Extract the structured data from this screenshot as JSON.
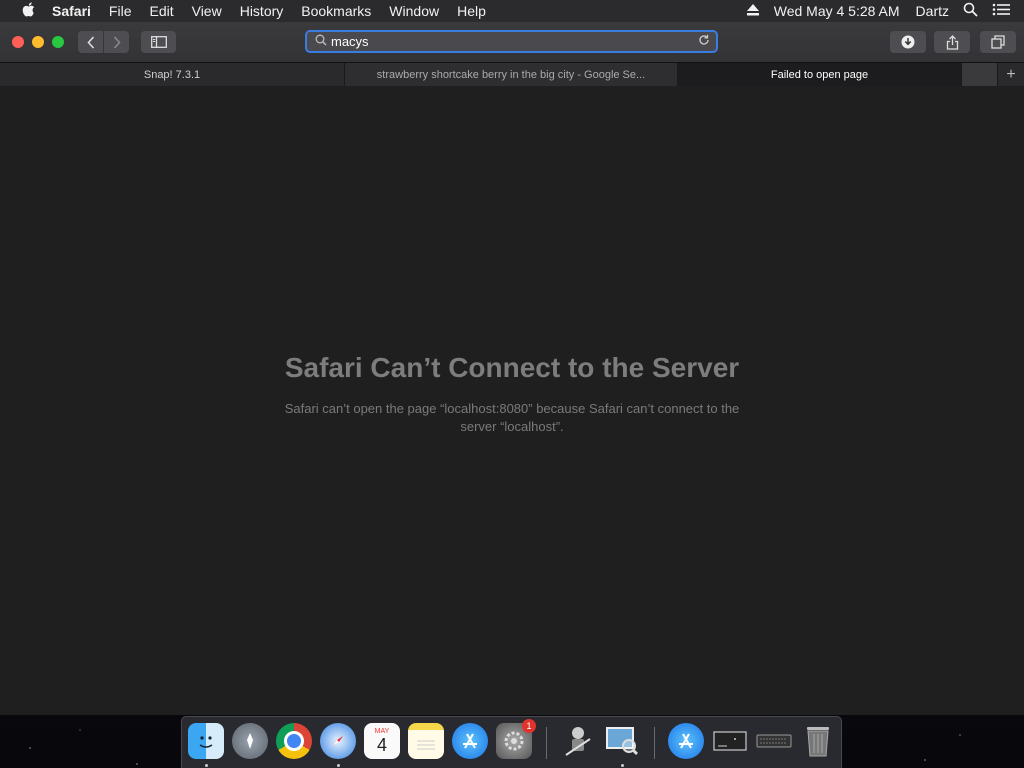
{
  "menubar": {
    "apple": "",
    "items": [
      "Safari",
      "File",
      "Edit",
      "View",
      "History",
      "Bookmarks",
      "Window",
      "Help"
    ],
    "clock": "Wed May 4  5:28 AM",
    "user": "Dartz"
  },
  "toolbar": {
    "address_value": "macys"
  },
  "tabs": [
    {
      "label": "Snap! 7.3.1"
    },
    {
      "label": "strawberry shortcake berry in the big city - Google Se..."
    },
    {
      "label": "Failed to open page"
    }
  ],
  "page": {
    "title": "Safari Can’t Connect to the Server",
    "message": "Safari can’t open the page “localhost:8080” because Safari can’t connect to the server “localhost”."
  },
  "dock": {
    "calendar_month": "MAY",
    "calendar_day": "4",
    "settings_badge": "1",
    "icons": [
      "finder-icon",
      "launchpad-icon",
      "chrome-icon",
      "safari-icon",
      "calendar-icon",
      "notes-icon",
      "app-store-icon",
      "system-preferences-icon",
      "automator-icon",
      "preview-icon",
      "app-store-downloads-icon",
      "screenshot-icon",
      "keyboard-icon",
      "trash-icon"
    ]
  },
  "colors": {
    "accent": "#3a7de0",
    "close": "#ff5f57",
    "minimize": "#febc2e",
    "maximize": "#28c840",
    "badge": "#e0332d"
  }
}
